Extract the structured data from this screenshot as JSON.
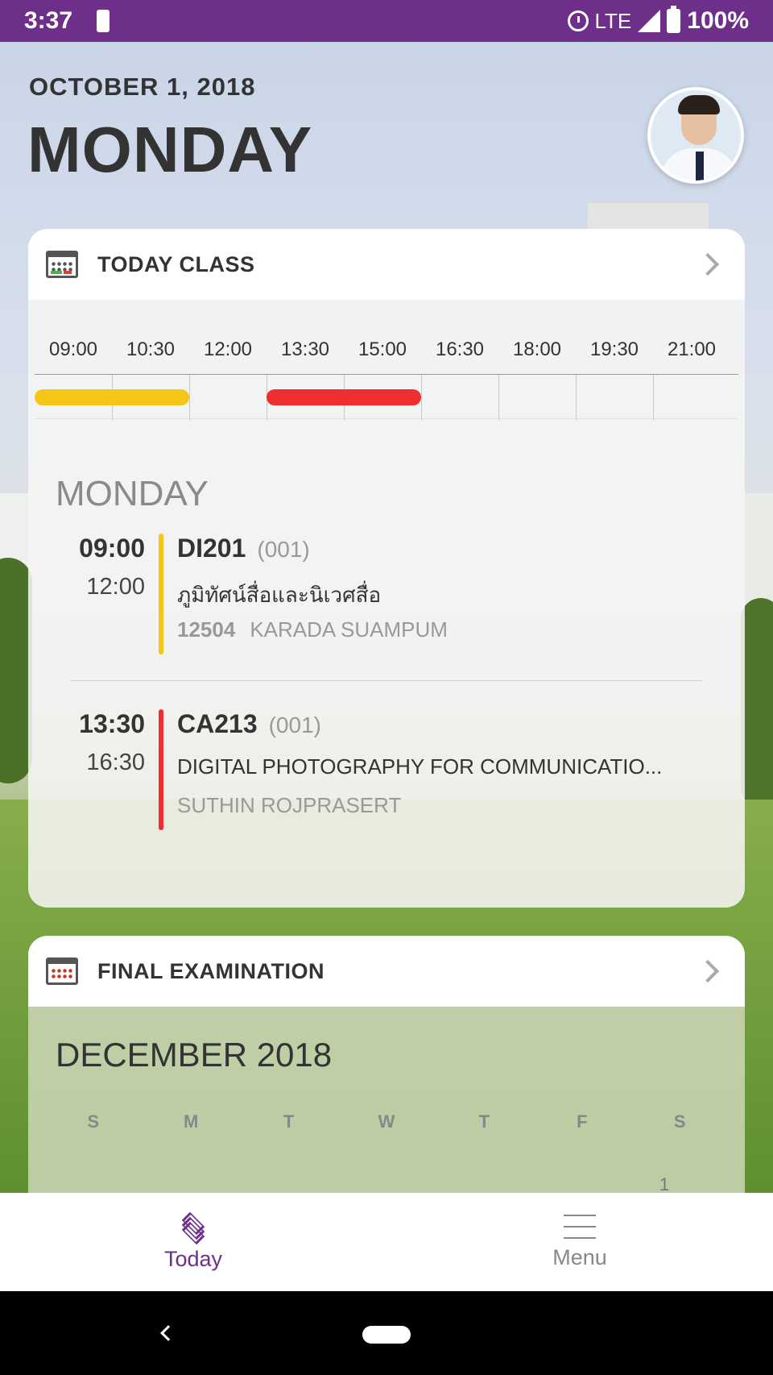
{
  "status_bar": {
    "time": "3:37",
    "network": "LTE",
    "battery": "100%"
  },
  "header": {
    "date": "OCTOBER 1, 2018",
    "day": "MONDAY"
  },
  "today_class": {
    "title": "TODAY CLASS",
    "timeline_labels": [
      "09:00",
      "10:30",
      "12:00",
      "13:30",
      "15:00",
      "16:30",
      "18:00",
      "19:30",
      "21:00"
    ],
    "bar_colors": {
      "first": "#f5c518",
      "second": "#ef2f2f"
    },
    "day_heading": "MONDAY",
    "classes": [
      {
        "start": "09:00",
        "end": "12:00",
        "code": "DI201",
        "section": "(001)",
        "name": "ภูมิทัศน์สื่อและนิเวศสื่อ",
        "room": "12504",
        "instructor": "KARADA SUAMPUM",
        "color": "#f5c518"
      },
      {
        "start": "13:30",
        "end": "16:30",
        "code": "CA213",
        "section": "(001)",
        "name": "DIGITAL PHOTOGRAPHY FOR COMMUNICATIO...",
        "room": "",
        "instructor": "SUTHIN ROJPRASERT",
        "color": "#ef2f2f"
      }
    ]
  },
  "final_exam": {
    "title": "FINAL EXAMINATION",
    "month": "DECEMBER 2018",
    "weekdays": [
      "S",
      "M",
      "T",
      "W",
      "T",
      "F",
      "S"
    ],
    "first_day": "1"
  },
  "bottom_nav": {
    "today_label": "Today",
    "menu_label": "Menu",
    "active_color": "#6e2f8a"
  }
}
